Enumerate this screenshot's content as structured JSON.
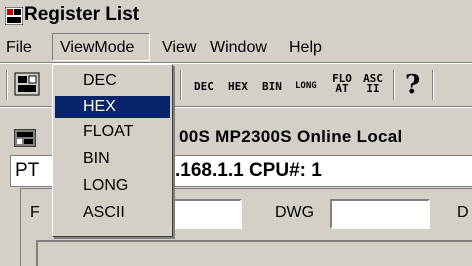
{
  "window": {
    "title": "Register List"
  },
  "menubar": {
    "items": [
      {
        "label": "File"
      },
      {
        "label": "ViewMode"
      },
      {
        "label": "View"
      },
      {
        "label": "Window"
      },
      {
        "label": "Help"
      }
    ]
  },
  "viewmode_menu": {
    "items": [
      {
        "label": "DEC",
        "selected": false
      },
      {
        "label": "HEX",
        "selected": true
      },
      {
        "label": "FLOAT",
        "selected": false
      },
      {
        "label": "BIN",
        "selected": false
      },
      {
        "label": "LONG",
        "selected": false
      },
      {
        "label": "ASCII",
        "selected": false
      }
    ]
  },
  "toolbar": {
    "dec": "DEC",
    "hex": "HEX",
    "bin": "BIN",
    "long": "LONG",
    "float_top": "FLO",
    "float_bottom": "AT",
    "ascii_top": "ASC",
    "ascii_bottom": "II",
    "help_glyph": "?"
  },
  "info": {
    "text": "00S MP2300S  Online Local"
  },
  "target": {
    "pt_label": "PT",
    "address": ".168.1.1 CPU#: 1"
  },
  "fields": {
    "f_label": "F",
    "f_value": "",
    "dwg_label": "DWG",
    "dwg_value": "",
    "d_label": "D"
  },
  "colors": {
    "selection": "#0a246a",
    "face": "#d4d0c8"
  }
}
